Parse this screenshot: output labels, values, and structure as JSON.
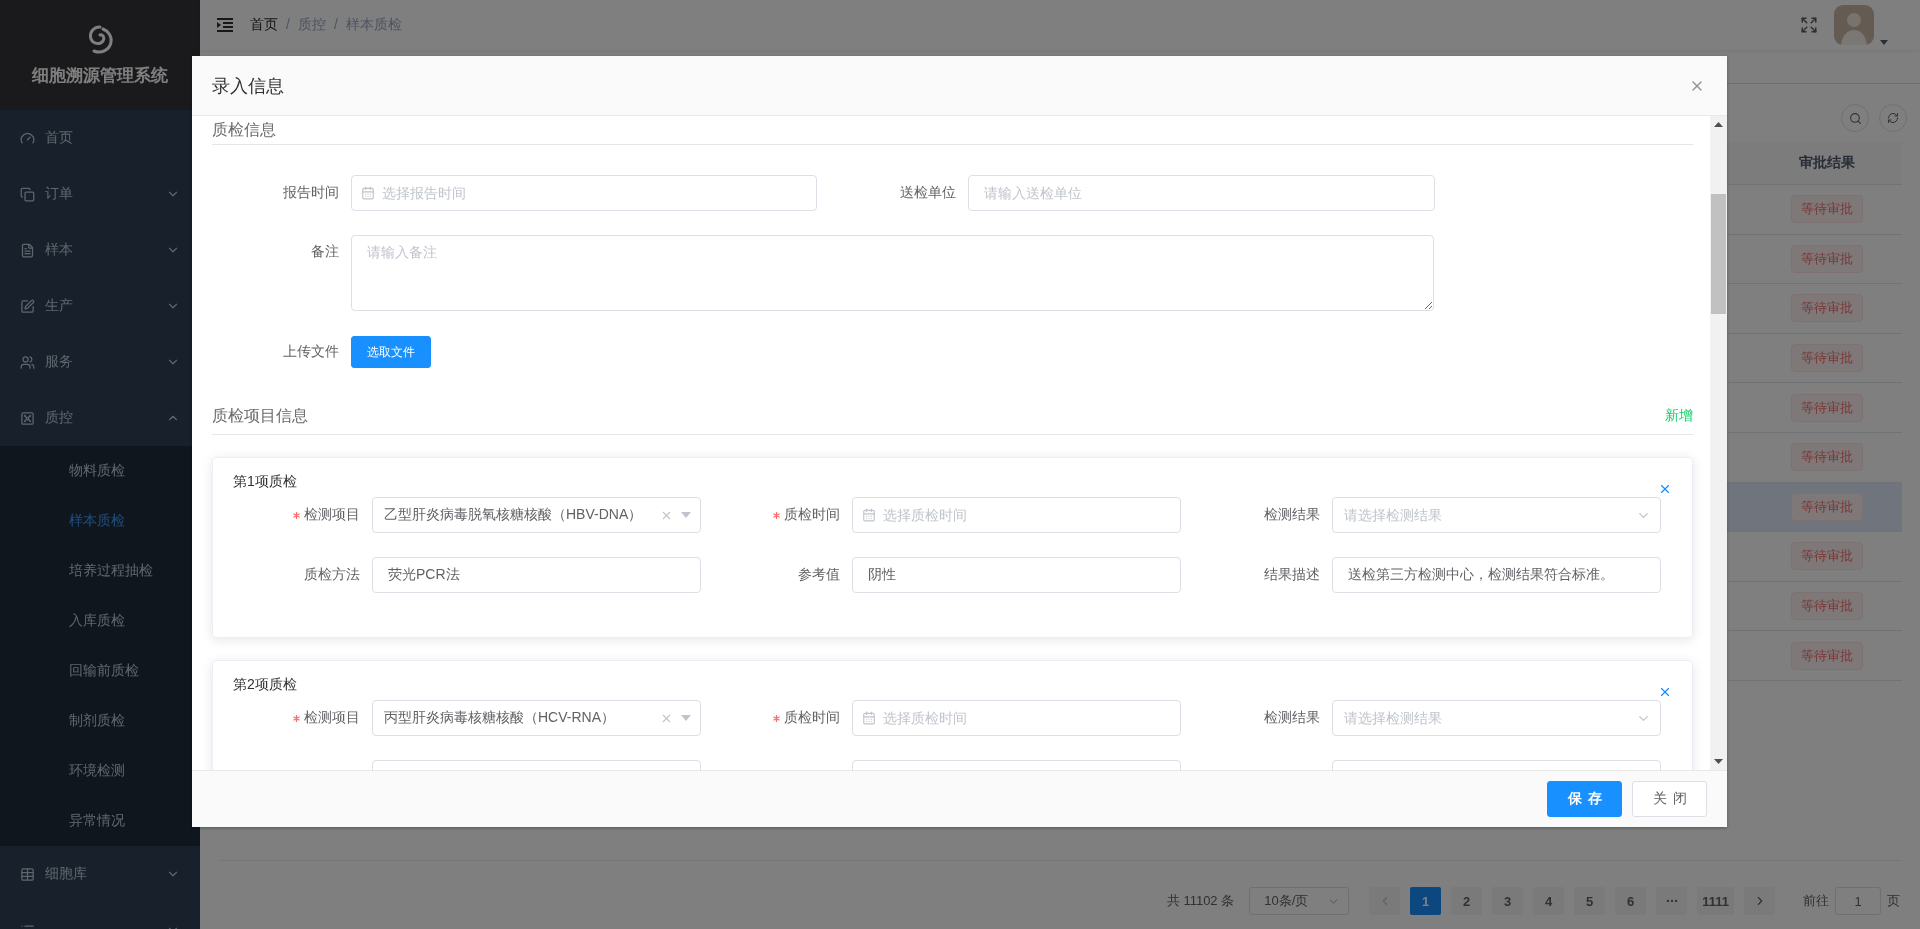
{
  "sidebar": {
    "title": "细胞溯源管理系统",
    "items": [
      {
        "label": "首页",
        "kind": "link"
      },
      {
        "label": "订单",
        "kind": "group",
        "expanded": false
      },
      {
        "label": "样本",
        "kind": "group",
        "expanded": false
      },
      {
        "label": "生产",
        "kind": "group",
        "expanded": false
      },
      {
        "label": "服务",
        "kind": "group",
        "expanded": false
      },
      {
        "label": "质控",
        "kind": "group",
        "expanded": true,
        "children": [
          {
            "label": "物料质检",
            "selected": false
          },
          {
            "label": "样本质检",
            "selected": true
          },
          {
            "label": "培养过程抽检",
            "selected": false
          },
          {
            "label": "入库质检",
            "selected": false
          },
          {
            "label": "回输前质检",
            "selected": false
          },
          {
            "label": "制剂质检",
            "selected": false
          },
          {
            "label": "环境检测",
            "selected": false
          },
          {
            "label": "异常情况",
            "selected": false
          }
        ]
      },
      {
        "label": "细胞库",
        "kind": "group",
        "expanded": false
      },
      {
        "kind": "group",
        "expanded": false
      }
    ]
  },
  "header": {
    "breadcrumb": [
      "首页",
      "质控",
      "样本质检"
    ],
    "separator": "/"
  },
  "table": {
    "columns": [
      "审批结果"
    ],
    "rows": [
      {
        "approval": "等待审批",
        "hovered": false
      },
      {
        "approval": "等待审批",
        "hovered": false
      },
      {
        "approval": "等待审批",
        "hovered": false
      },
      {
        "approval": "等待审批",
        "hovered": false
      },
      {
        "approval": "等待审批",
        "hovered": false
      },
      {
        "approval": "等待审批",
        "hovered": false
      },
      {
        "approval": "等待审批",
        "hovered": true
      },
      {
        "approval": "等待审批",
        "hovered": false
      },
      {
        "approval": "等待审批",
        "hovered": false
      },
      {
        "approval": "等待审批",
        "hovered": false
      }
    ]
  },
  "pagination": {
    "total": "共 11102 条",
    "page_size": "10条/页",
    "pages": [
      {
        "kind": "page",
        "label": "1",
        "selected": true
      },
      {
        "kind": "page",
        "label": "2",
        "selected": false
      },
      {
        "kind": "page",
        "label": "3",
        "selected": false
      },
      {
        "kind": "page",
        "label": "4",
        "selected": false
      },
      {
        "kind": "page",
        "label": "5",
        "selected": false
      },
      {
        "kind": "page",
        "label": "6",
        "selected": false
      },
      {
        "kind": "more",
        "selected": false
      },
      {
        "kind": "page",
        "label": "1111",
        "selected": false
      }
    ],
    "jump_label": "前往",
    "jump_value": "1",
    "jump_suffix": "页"
  },
  "dialog": {
    "title": "录入信息",
    "info_section": {
      "heading": "质检信息",
      "report_time": {
        "label": "报告时间",
        "placeholder": "选择报告时间"
      },
      "unit": {
        "label": "送检单位",
        "placeholder": "请输入送检单位"
      },
      "remark": {
        "label": "备注",
        "placeholder": "请输入备注"
      },
      "upload": {
        "label": "上传文件",
        "button": "选取文件"
      }
    },
    "items_section": {
      "heading": "质检项目信息",
      "add_link": "新增",
      "items": [
        {
          "title": "第1项质检",
          "fields": [
            {
              "kind": "select",
              "label": "检测项目",
              "required": true,
              "value": "乙型肝炎病毒脱氧核糖核酸（HBV-DNA）",
              "clearable": true
            },
            {
              "kind": "date",
              "label": "质检时间",
              "required": true,
              "placeholder": "选择质检时间"
            },
            {
              "kind": "select",
              "label": "检测结果",
              "required": false,
              "placeholder": "请选择检测结果",
              "clearable": false
            },
            {
              "kind": "input",
              "label": "质检方法",
              "required": false,
              "value": "荧光PCR法"
            },
            {
              "kind": "input",
              "label": "参考值",
              "required": false,
              "value": "阴性"
            },
            {
              "kind": "input",
              "label": "结果描述",
              "required": false,
              "value": "送检第三方检测中心，检测结果符合标准。"
            }
          ]
        },
        {
          "title": "第2项质检",
          "fields": [
            {
              "kind": "select",
              "label": "检测项目",
              "required": true,
              "value": "丙型肝炎病毒核糖核酸（HCV-RNA）",
              "clearable": true
            },
            {
              "kind": "date",
              "label": "质检时间",
              "required": true,
              "placeholder": "选择质检时间"
            },
            {
              "kind": "select",
              "label": "检测结果",
              "required": false,
              "placeholder": "请选择检测结果",
              "clearable": false
            },
            {
              "kind": "input",
              "required": false
            },
            {
              "kind": "input",
              "required": false
            },
            {
              "kind": "input",
              "required": false
            }
          ]
        }
      ]
    },
    "buttons": [
      {
        "label": "保存",
        "kind": "primary"
      },
      {
        "label": "关闭",
        "kind": "default"
      }
    ]
  }
}
